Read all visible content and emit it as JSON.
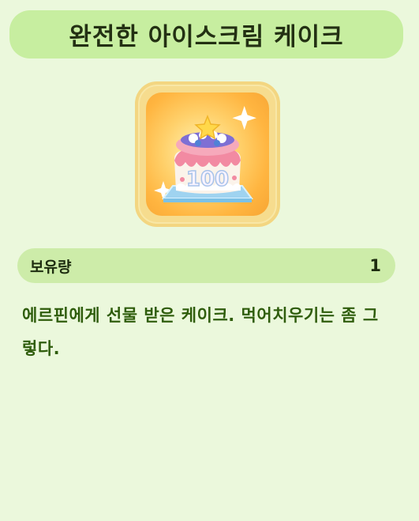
{
  "item": {
    "title": "완전한 아이스크림 케이크",
    "icon_name": "ice-cream-cake-icon",
    "icon_badge": "100",
    "quantity_label": "보유량",
    "quantity_value": "1",
    "description": "에르핀에게 선물 받은 케이크. 먹어치우기는 좀 그렇다."
  },
  "colors": {
    "background": "#ebf8dc",
    "title_bar": "#c7eea0",
    "quantity_bar": "#cdeca9",
    "description_text": "#2f5d0c",
    "icon_frame": "#f6dc8e"
  }
}
